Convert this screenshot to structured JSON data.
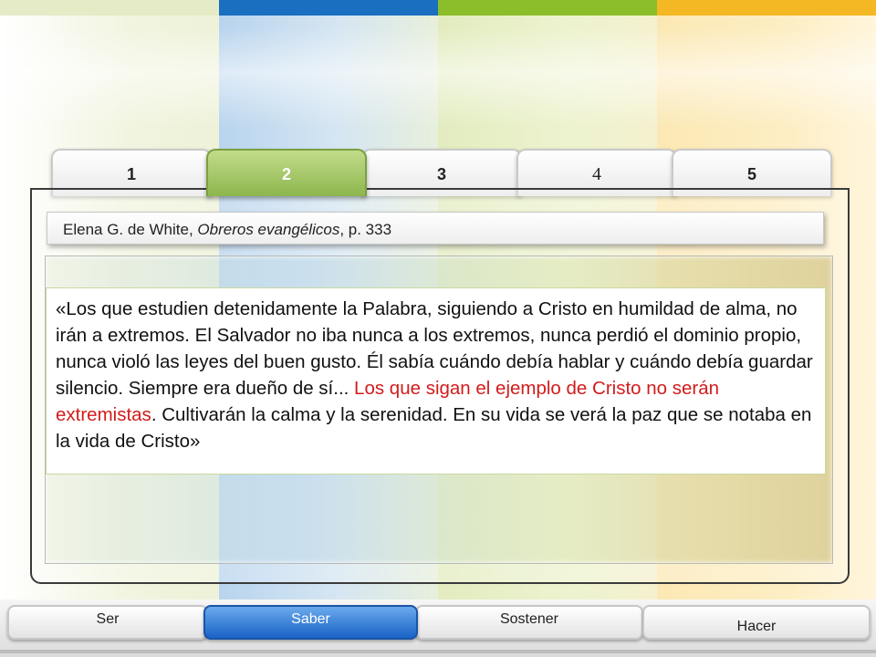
{
  "tabs": [
    {
      "label": "1",
      "active": false
    },
    {
      "label": "2",
      "active": true
    },
    {
      "label": "3",
      "active": false
    },
    {
      "label": "4",
      "active": false
    },
    {
      "label": "5",
      "active": false
    }
  ],
  "citation": {
    "author": "Elena G. de White, ",
    "book": "Obreros evangélicos",
    "page": ", p. 333"
  },
  "quote": {
    "part1": "«Los que estudien detenidamente la Palabra, siguiendo a Cristo en humildad de alma, no irán a extremos.  El Salvador no iba nunca a los extremos, nunca perdió el dominio propio, nunca violó las leyes del buen gusto.  Él sabía cuándo debía hablar y cuándo debía guardar silencio.  Siempre era dueño de sí... ",
    "highlight": "Los que sigan el ejemplo de Cristo no serán extremistas",
    "part2": ".  Cultivarán la calma y la serenidad.  En su vida se verá la paz que se notaba en la vida de Cristo»"
  },
  "nav": [
    {
      "label": "Ser",
      "active": false
    },
    {
      "label": "Saber",
      "active": true
    },
    {
      "label": "Sostener",
      "active": false
    },
    {
      "label": "Hacer",
      "active": false
    }
  ],
  "colors": {
    "highlight": "#d21c1c",
    "active_tab": "#8cb64e",
    "active_nav": "#1a63c7"
  }
}
